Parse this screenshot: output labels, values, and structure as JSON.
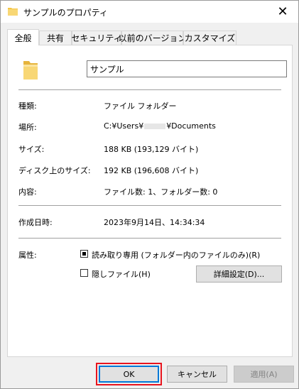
{
  "window": {
    "title": "サンプルのプロパティ",
    "close_glyph": "✕"
  },
  "tabs": [
    {
      "label": "全般",
      "active": true
    },
    {
      "label": "共有"
    },
    {
      "label": "セキュリティ"
    },
    {
      "label": "以前のバージョン"
    },
    {
      "label": "カスタマイズ"
    }
  ],
  "general": {
    "folder_name": "サンプル",
    "rows": [
      {
        "label": "種類:",
        "value": "ファイル フォルダー"
      },
      {
        "label": "場所:",
        "value_prefix": "C:¥Users¥",
        "value_suffix": "¥Documents"
      },
      {
        "label": "サイズ:",
        "value": "188 KB (193,129 バイト)"
      },
      {
        "label": "ディスク上のサイズ:",
        "value": "192 KB (196,608 バイト)"
      },
      {
        "label": "内容:",
        "value": "ファイル数: 1、フォルダー数: 0"
      },
      {
        "label": "作成日時:",
        "value": "2023年9月14日、14:34:34"
      }
    ],
    "attributes": {
      "label": "属性:",
      "readonly": {
        "label": "読み取り専用 (フォルダー内のファイルのみ)(R)",
        "state": "indeterminate"
      },
      "hidden": {
        "label": "隠しファイル(H)",
        "checked": false
      },
      "advanced_button": "詳細設定(D)..."
    }
  },
  "footer": {
    "ok": "OK",
    "cancel": "キャンセル",
    "apply": "適用(A)"
  },
  "colors": {
    "highlight": "#e8141e",
    "folder": "#f4c542",
    "focus": "#0078d7"
  },
  "icons": {
    "title": "folder-icon",
    "large": "folder-icon"
  }
}
